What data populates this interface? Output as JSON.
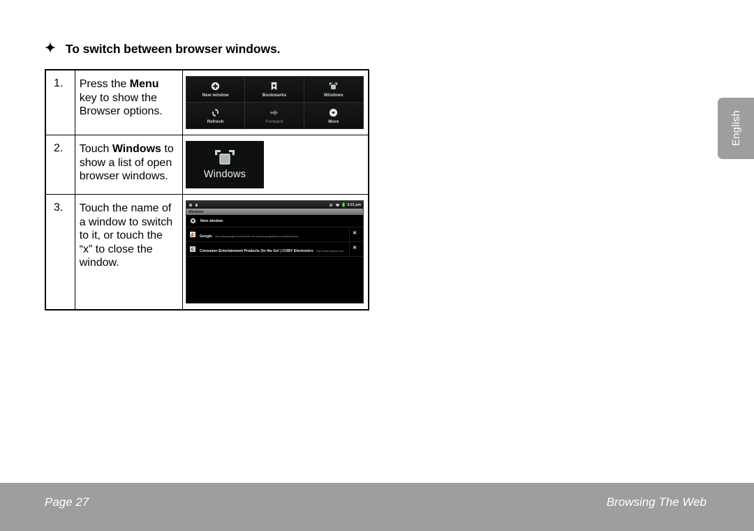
{
  "page": {
    "heading": {
      "bullet_icon": "four-point-star-icon",
      "text": "To switch between browser windows."
    },
    "steps": [
      {
        "number": "1.",
        "text_parts": {
          "pre": "Press the ",
          "bold": "Menu",
          "post": " key to show the Browser options."
        }
      },
      {
        "number": "2.",
        "text_parts": {
          "pre": "Touch ",
          "bold": "Windows",
          "post": " to show a list of open browser windows."
        }
      },
      {
        "number": "3.",
        "text_parts": {
          "pre": "Touch the name of a window to switch to it, or touch the “x” to close the window.",
          "bold": "",
          "post": ""
        }
      }
    ],
    "browser_menu": {
      "items": [
        {
          "label": "New window",
          "icon": "plus-circle-icon",
          "disabled": false
        },
        {
          "label": "Bookmarks",
          "icon": "bookmark-star-icon",
          "disabled": false
        },
        {
          "label": "Windows",
          "icon": "windows-stack-icon",
          "disabled": false
        },
        {
          "label": "Refresh",
          "icon": "refresh-icon",
          "disabled": false
        },
        {
          "label": "Forward",
          "icon": "arrow-right-icon",
          "disabled": true
        },
        {
          "label": "More",
          "icon": "chevron-down-circle-icon",
          "disabled": false
        }
      ]
    },
    "windows_tile": {
      "label": "Windows",
      "icon": "windows-stack-icon"
    },
    "device_screenshot": {
      "status_bar": {
        "left_icons": [
          "sync-icon",
          "usb-debug-icon"
        ],
        "right_icons": [
          "globe-icon",
          "wifi-icon",
          "battery-icon"
        ],
        "time": "3:21 pm"
      },
      "title_bar": {
        "title": "Windows"
      },
      "list": {
        "new_window_label": "New window",
        "new_window_icon": "plus-circle-icon",
        "rows": [
          {
            "favicon": "google-favicon",
            "title": "Google",
            "url": "http://www.google.com/m/client=ms-android-google&source=android-home",
            "close_label": "✕"
          },
          {
            "favicon": "coby-favicon",
            "title": "Consumer Entertainment Products On the Go! | COBY Electronics",
            "url": "http://www.cobyusa.com",
            "close_label": "✕"
          }
        ]
      }
    },
    "language_tab": {
      "label": "English"
    },
    "footer": {
      "page_label": "Page 27",
      "section_label": "Browsing The Web"
    },
    "colors": {
      "footer_gray": "#9e9e9e",
      "device_black": "#000000",
      "menu_dark": "#111214",
      "text_black": "#000000"
    }
  }
}
